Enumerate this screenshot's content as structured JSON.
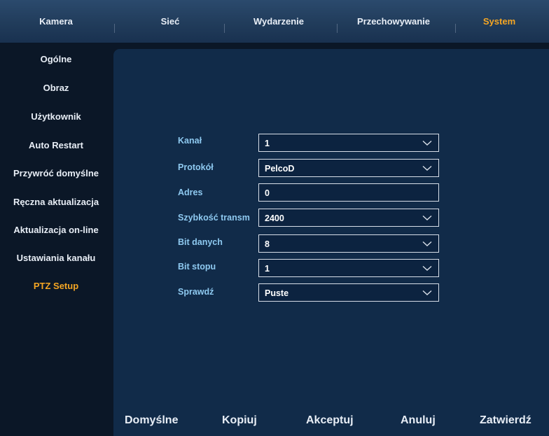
{
  "tabs": [
    {
      "label": "Kamera",
      "active": false
    },
    {
      "label": "Sieć",
      "active": false
    },
    {
      "label": "Wydarzenie",
      "active": false
    },
    {
      "label": "Przechowywanie",
      "active": false
    },
    {
      "label": "System",
      "active": true
    }
  ],
  "sidebar": {
    "items": [
      {
        "label": "Ogólne"
      },
      {
        "label": "Obraz"
      },
      {
        "label": "Użytkownik"
      },
      {
        "label": "Auto Restart"
      },
      {
        "label": "Przywróć domyślne"
      },
      {
        "label": "Ręczna aktualizacja"
      },
      {
        "label": "Aktualizacja on-line"
      },
      {
        "label": "Ustawiania kanału"
      },
      {
        "label": "PTZ Setup",
        "active": true
      }
    ]
  },
  "form": {
    "fields": [
      {
        "label": "Kanał",
        "value": "1",
        "type": "select"
      },
      {
        "label": "Protokół",
        "value": "PelcoD",
        "type": "select"
      },
      {
        "label": "Adres",
        "value": "0",
        "type": "input"
      },
      {
        "label": "Szybkość transm",
        "value": "2400",
        "type": "select"
      },
      {
        "label": "Bit danych",
        "value": "8",
        "type": "select"
      },
      {
        "label": "Bit stopu",
        "value": "1",
        "type": "select"
      },
      {
        "label": "Sprawdź",
        "value": "Puste",
        "type": "select"
      }
    ]
  },
  "buttons": {
    "default": "Domyślne",
    "copy": "Kopiuj",
    "accept": "Akceptuj",
    "cancel": "Anuluj",
    "confirm": "Zatwierdź"
  },
  "colors": {
    "accent": "#f5a623",
    "label": "#8ec9f0",
    "panel": "#112b49",
    "background": "#0b1727"
  }
}
